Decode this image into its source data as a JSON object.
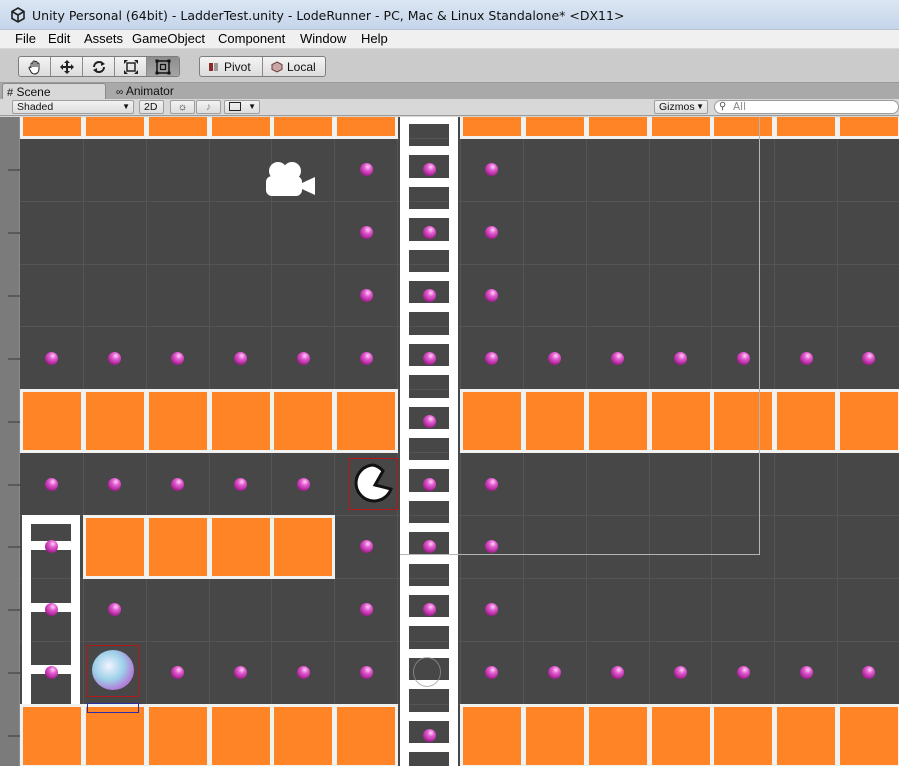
{
  "window": {
    "title": "Unity Personal (64bit) - LadderTest.unity - LodeRunner - PC, Mac & Linux Standalone* <DX11>"
  },
  "menu": [
    "File",
    "Edit",
    "Assets",
    "GameObject",
    "Component",
    "Window",
    "Help"
  ],
  "toolbar": {
    "tools": [
      "hand-tool",
      "move-tool",
      "rotate-tool",
      "scale-tool",
      "rect-tool"
    ],
    "active_tool": "rect-tool",
    "pivot_label": "Pivot",
    "local_label": "Local"
  },
  "tabs": [
    {
      "label": "Scene",
      "icon": "grid-icon"
    },
    {
      "label": "Animator",
      "icon": "animator-icon"
    }
  ],
  "scene_bar": {
    "shading": "Shaded",
    "mode_2d": "2D",
    "gizmos": "Gizmos",
    "search_placeholder": "All"
  },
  "scene": {
    "colors": {
      "background": "#474747",
      "block": "#fe8426",
      "block_border": "#f1f1ef",
      "coin": "#c23fb2",
      "ladder": "#ffffff",
      "selection": "#b31818"
    },
    "objects": [
      "main-camera",
      "enemy",
      "player"
    ]
  }
}
